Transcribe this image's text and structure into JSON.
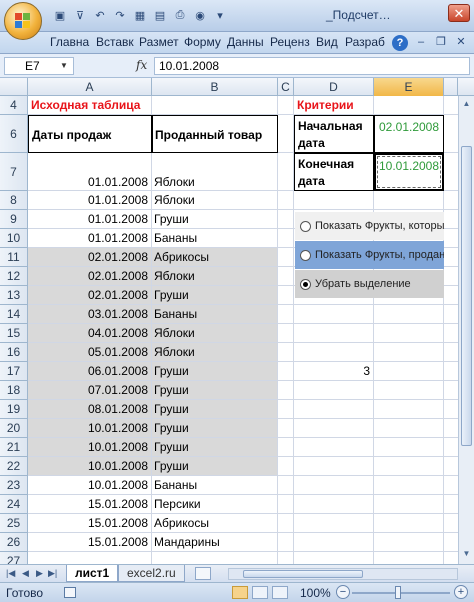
{
  "title": "_Подсчет…",
  "quick_access": [
    "save-icon",
    "filter-icon",
    "undo-icon",
    "redo-icon",
    "grid-icon",
    "form-icon",
    "print-icon",
    "circle-icon",
    "dropdown-icon"
  ],
  "ribbon_tabs": [
    "Главна",
    "Вставк",
    "Размет",
    "Форму",
    "Данны",
    "Реценз",
    "Вид",
    "Разраб"
  ],
  "help": "?",
  "formula_bar": {
    "name_box": "E7",
    "fx": "fx",
    "formula": "10.01.2008"
  },
  "columns": [
    "A",
    "B",
    "C",
    "D",
    "E"
  ],
  "row_numbers": [
    "4",
    "6",
    "7",
    "8",
    "9",
    "10",
    "11",
    "12",
    "13",
    "14",
    "15",
    "16",
    "17",
    "18",
    "19",
    "20",
    "21",
    "22",
    "23",
    "24",
    "25",
    "26",
    "27"
  ],
  "table": {
    "title": "Исходная таблица",
    "col_a_header": "Даты продаж",
    "col_b_header": "Проданный товар",
    "rows": [
      {
        "date": "01.01.2008",
        "product": "Яблоки",
        "shaded": false
      },
      {
        "date": "01.01.2008",
        "product": "Яблоки",
        "shaded": false
      },
      {
        "date": "01.01.2008",
        "product": "Груши",
        "shaded": false
      },
      {
        "date": "01.01.2008",
        "product": "Бананы",
        "shaded": false
      },
      {
        "date": "02.01.2008",
        "product": "Абрикосы",
        "shaded": true
      },
      {
        "date": "02.01.2008",
        "product": "Яблоки",
        "shaded": true
      },
      {
        "date": "02.01.2008",
        "product": "Груши",
        "shaded": true
      },
      {
        "date": "03.01.2008",
        "product": "Бананы",
        "shaded": true
      },
      {
        "date": "04.01.2008",
        "product": "Яблоки",
        "shaded": true
      },
      {
        "date": "05.01.2008",
        "product": "Яблоки",
        "shaded": true
      },
      {
        "date": "06.01.2008",
        "product": "Груши",
        "shaded": true
      },
      {
        "date": "07.01.2008",
        "product": "Груши",
        "shaded": true
      },
      {
        "date": "08.01.2008",
        "product": "Груши",
        "shaded": true
      },
      {
        "date": "10.01.2008",
        "product": "Груши",
        "shaded": true
      },
      {
        "date": "10.01.2008",
        "product": "Груши",
        "shaded": true
      },
      {
        "date": "10.01.2008",
        "product": "Груши",
        "shaded": true
      },
      {
        "date": "10.01.2008",
        "product": "Бананы",
        "shaded": false
      },
      {
        "date": "15.01.2008",
        "product": "Персики",
        "shaded": false
      },
      {
        "date": "15.01.2008",
        "product": "Абрикосы",
        "shaded": false
      },
      {
        "date": "15.01.2008",
        "product": "Мандарины",
        "shaded": false
      }
    ]
  },
  "criteria": {
    "title": "Критерии",
    "start_label": "Начальная дата",
    "start_value": "02.01.2008",
    "end_label": "Конечная дата",
    "end_value": "10.01.2008"
  },
  "options": [
    {
      "label": "Показать Фрукты, которые п",
      "selected": false,
      "bg": "#f0f0f0"
    },
    {
      "label": "Показать Фрукты, проданны",
      "selected": false,
      "bg": "#7fa5d8"
    },
    {
      "label": "Убрать выделение",
      "selected": true,
      "bg": "#d0d0d0"
    }
  ],
  "count_value": "3",
  "sheets": {
    "active": "лист1",
    "other": "excel2.ru"
  },
  "status": {
    "ready": "Готово",
    "zoom": "100%"
  },
  "colors": {
    "accent_red": "#e8141a",
    "criteria_green": "#2f9a3a",
    "selected_header": "#f1b748"
  }
}
